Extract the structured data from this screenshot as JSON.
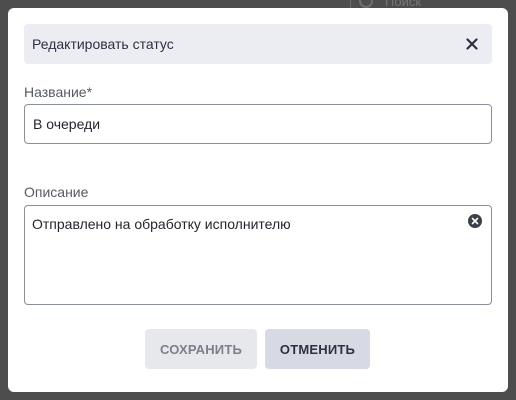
{
  "background": {
    "search_placeholder": "Поиск",
    "search_icon": "search-icon"
  },
  "dialog": {
    "title": "Редактировать статус",
    "close_icon": "close-icon",
    "name_label": "Название*",
    "name_value": "В очереди",
    "description_label": "Описание",
    "description_value": "Отправлено на обработку исполнителю",
    "clear_icon": "clear-icon",
    "save_label": "СОХРАНИТЬ",
    "cancel_label": "ОТМЕНИТЬ"
  },
  "colors": {
    "header_bg": "#ecedf2",
    "save_bg": "#e7e8ec",
    "cancel_bg": "#d8dae3",
    "text_dark": "#2d3142",
    "overlay": "#4d4d4d"
  }
}
